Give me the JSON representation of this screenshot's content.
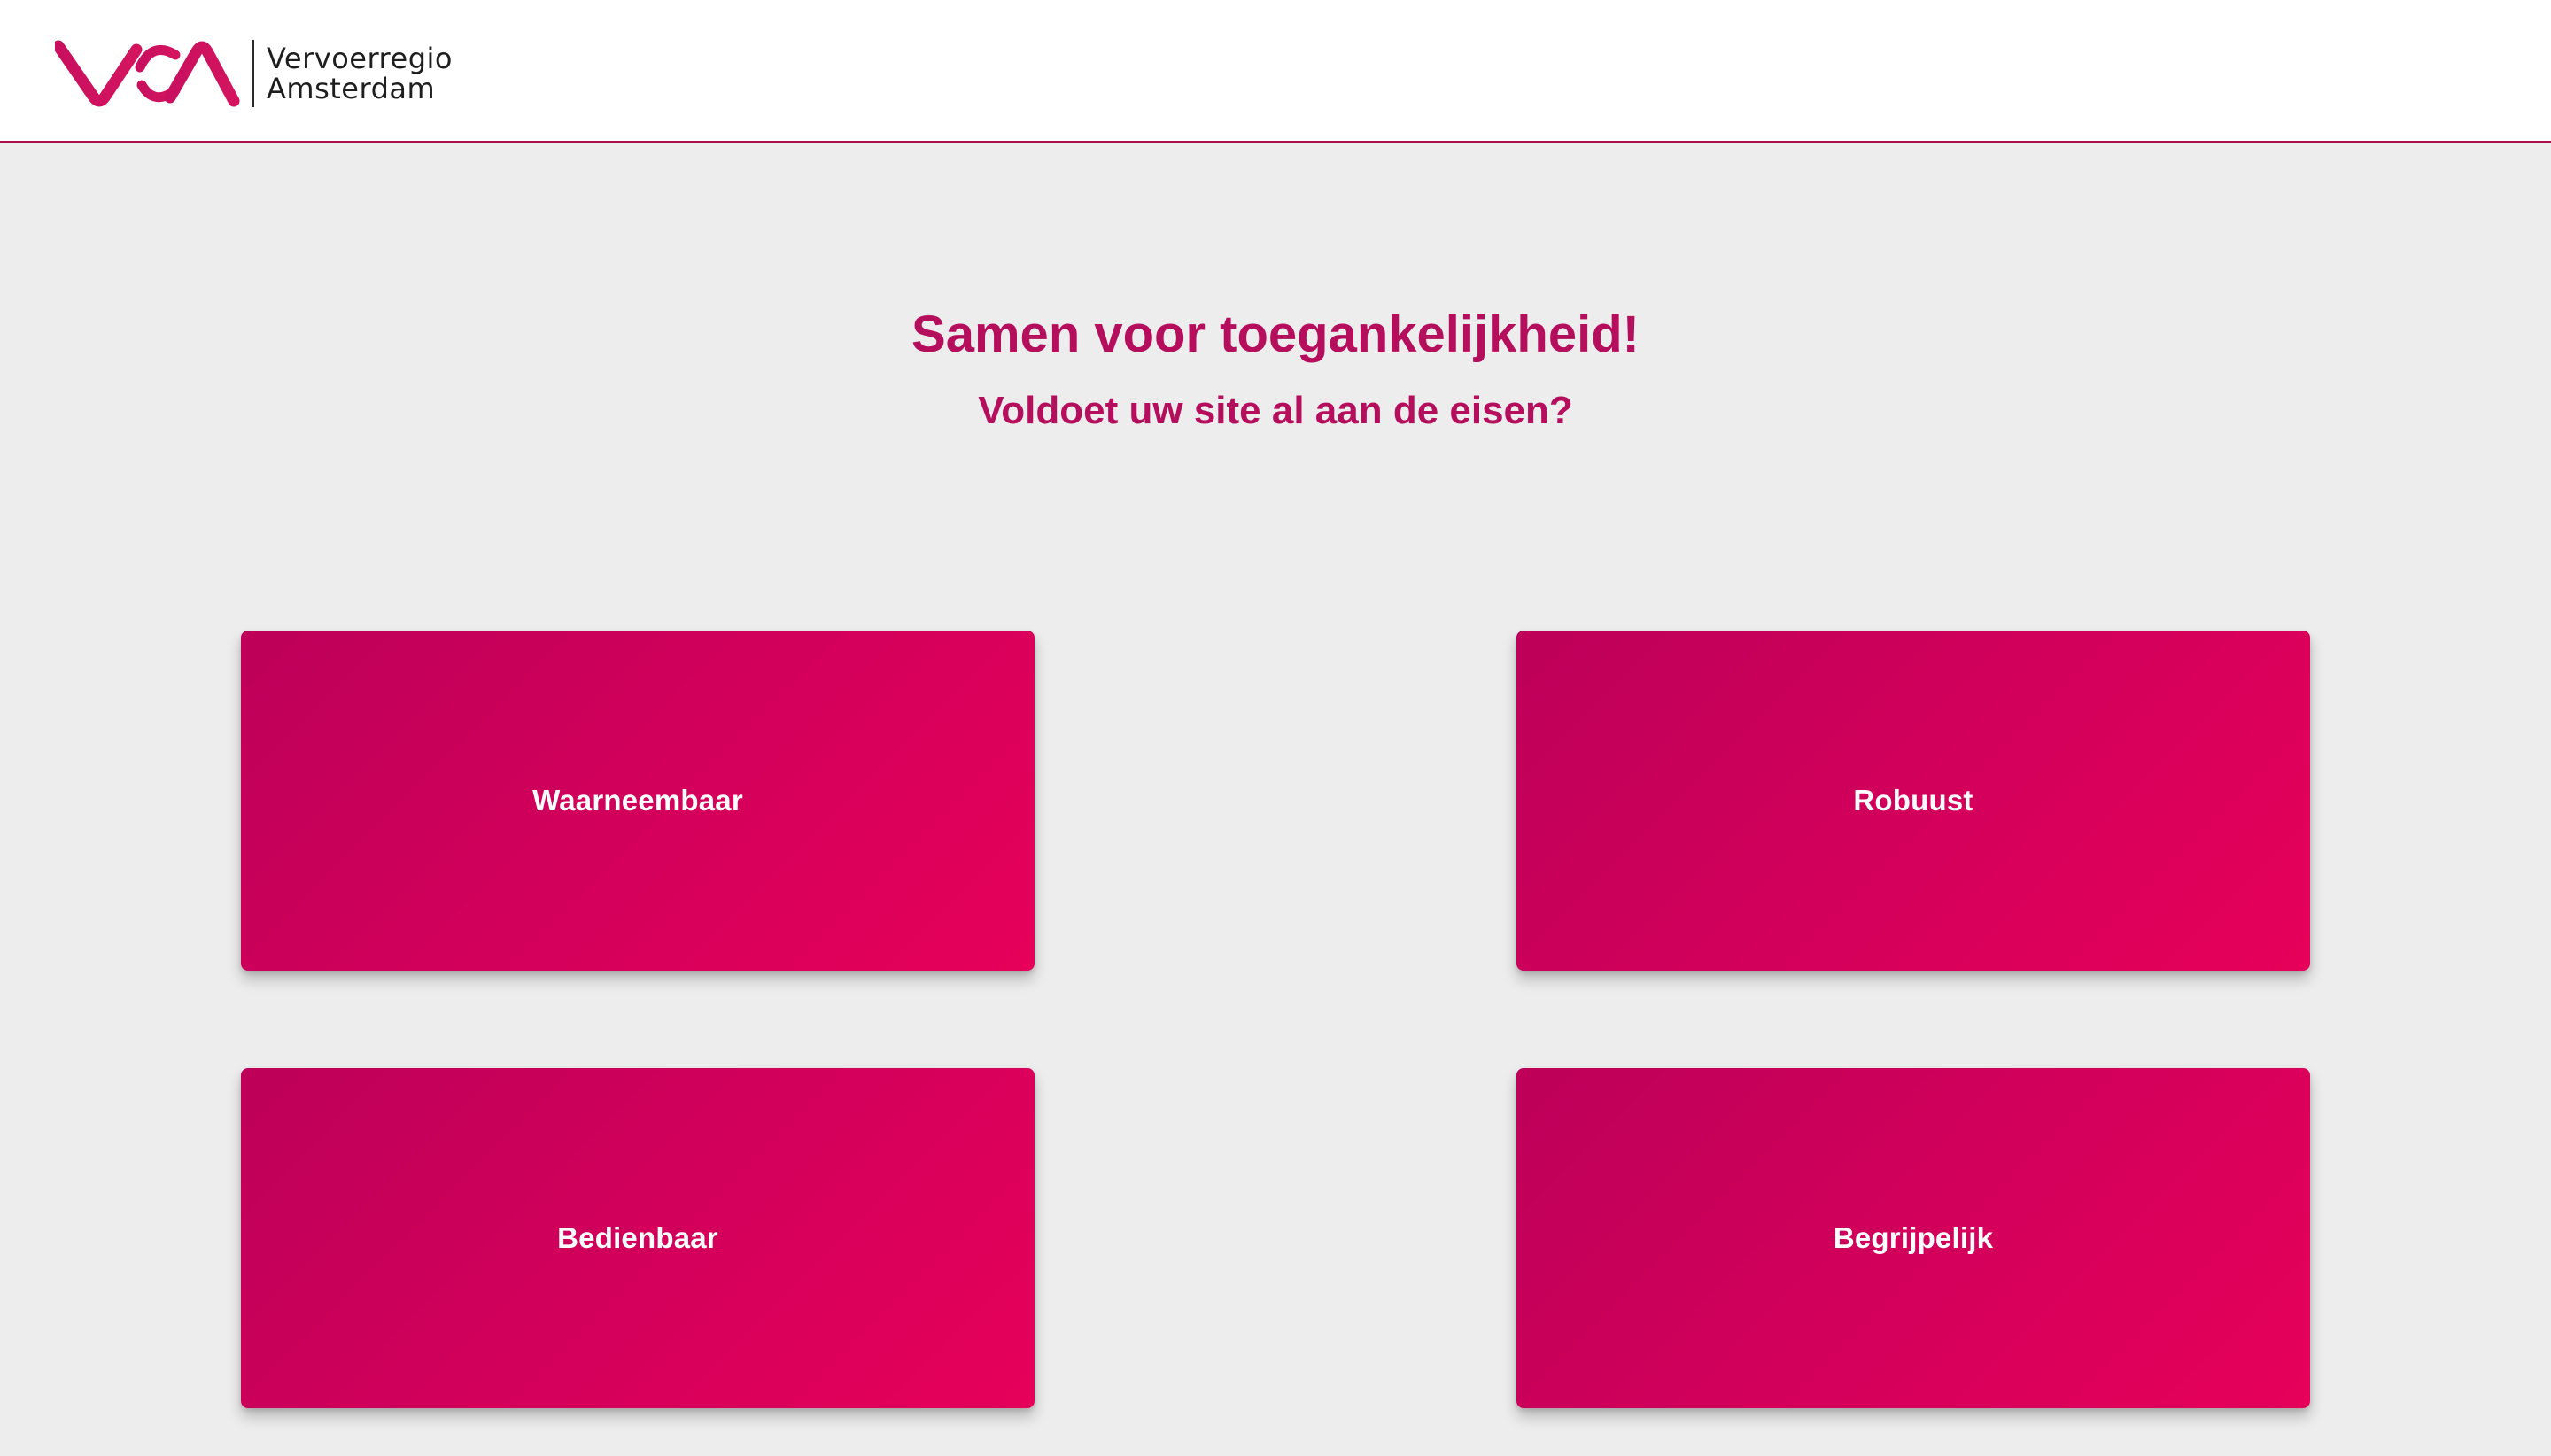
{
  "header": {
    "logo": {
      "name_line_1": "Vervoerregio",
      "name_line_2": "Amsterdam",
      "brand_color": "#c8105f"
    }
  },
  "main": {
    "title": "Samen voor toegankelijkheid!",
    "subtitle": "Voldoet uw site al aan de eisen?",
    "cards": [
      {
        "label": "Waarneembaar"
      },
      {
        "label": "Robuust"
      },
      {
        "label": "Bedienbaar"
      },
      {
        "label": "Begrijpelijk"
      }
    ]
  },
  "colors": {
    "accent": "#b50e5c",
    "card_gradient_start": "#bd0059",
    "card_gradient_end": "#e6005a",
    "background": "#ededed",
    "header_border": "#a8104f"
  }
}
